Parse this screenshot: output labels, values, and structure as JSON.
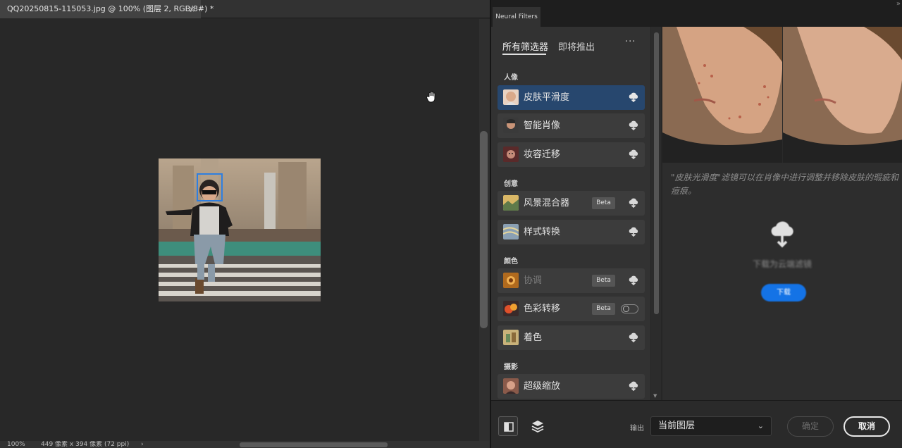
{
  "document": {
    "tab_title": "QQ20250815-115053.jpg @ 100% (图层 2, RGB/8#) *",
    "tab_close": "×",
    "status_zoom": "100%",
    "status_dims": "449 像素 x 394 像素 (72 ppi)",
    "status_arrow": "›"
  },
  "neural_filters": {
    "panel_tab": "Neural Filters",
    "collapse_glyph": "»",
    "tabs": [
      {
        "label": "所有筛选器",
        "active": true
      },
      {
        "label": "即将推出",
        "active": false
      }
    ],
    "more_glyph": "···",
    "categories": [
      {
        "label": "人像",
        "items": [
          {
            "label": "皮肤平滑度",
            "selected": true,
            "beta": false,
            "control": "cloud"
          },
          {
            "label": "智能肖像",
            "selected": false,
            "beta": false,
            "control": "cloud"
          },
          {
            "label": "妆容迁移",
            "selected": false,
            "beta": false,
            "control": "cloud"
          }
        ]
      },
      {
        "label": "创意",
        "items": [
          {
            "label": "风景混合器",
            "selected": false,
            "beta": true,
            "control": "cloud"
          },
          {
            "label": "样式转换",
            "selected": false,
            "beta": false,
            "control": "cloud"
          }
        ]
      },
      {
        "label": "颜色",
        "items": [
          {
            "label": "协调",
            "selected": false,
            "beta": true,
            "control": "cloud",
            "dimmed": true
          },
          {
            "label": "色彩转移",
            "selected": false,
            "beta": true,
            "control": "toggle"
          },
          {
            "label": "着色",
            "selected": false,
            "beta": false,
            "control": "cloud"
          }
        ]
      },
      {
        "label": "摄影",
        "items": [
          {
            "label": "超级缩放",
            "selected": false,
            "beta": false,
            "control": "cloud"
          }
        ]
      }
    ],
    "beta_label": "Beta",
    "detail": {
      "description": "\"皮肤光滑度\"滤镜可以在肖像中进行调整并移除皮肤的瑕疵和痘痕。",
      "download_text": "下载为云端滤镜",
      "download_button": "下载"
    },
    "footer": {
      "output_label": "输出",
      "output_value": "当前图层",
      "ok_label": "确定",
      "cancel_label": "取消"
    }
  },
  "colors": {
    "selected_item": "#27476e",
    "accent_blue": "#1473e6",
    "panel_bg": "#323232",
    "canvas_bg": "#282828"
  }
}
